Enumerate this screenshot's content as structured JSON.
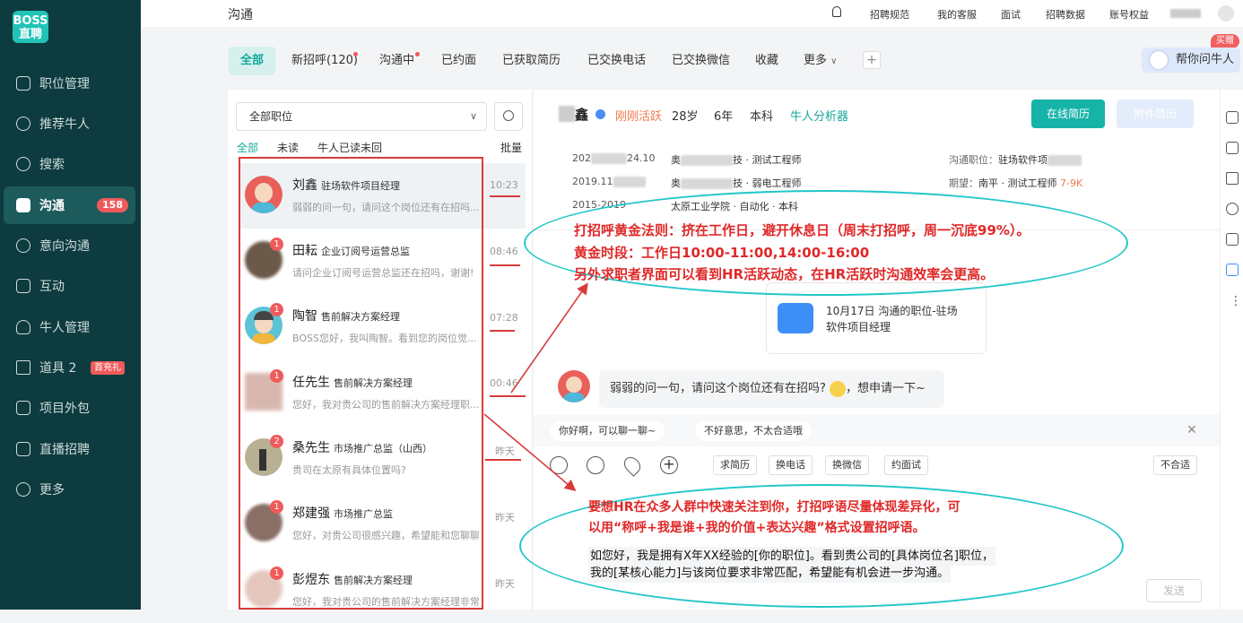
{
  "sidebar": {
    "logo_top": "BOSS",
    "logo_bottom": "直聘",
    "items": [
      {
        "label": "职位管理",
        "icon": "briefcase-icon"
      },
      {
        "label": "推荐牛人",
        "icon": "face-icon"
      },
      {
        "label": "搜索",
        "icon": "search-icon"
      },
      {
        "label": "沟通",
        "icon": "chat-icon",
        "badge": "158",
        "active": true
      },
      {
        "label": "意向沟通",
        "icon": "check-circle-icon"
      },
      {
        "label": "互动",
        "icon": "interaction-icon"
      },
      {
        "label": "牛人管理",
        "icon": "user-icon"
      },
      {
        "label": "道具 2",
        "icon": "star-icon",
        "badge": "首充礼"
      },
      {
        "label": "项目外包",
        "icon": "document-icon"
      },
      {
        "label": "直播招聘",
        "icon": "calendar-icon"
      },
      {
        "label": "更多",
        "icon": "more-icon"
      }
    ]
  },
  "topbar": {
    "title": "沟通",
    "links": [
      "招聘规范",
      "我的客服",
      "面试",
      "招聘数据",
      "账号权益"
    ]
  },
  "tabs": {
    "items": [
      "全部",
      "新招呼(120)",
      "沟通中",
      "已约面",
      "已获取简历",
      "已交换电话",
      "已交换微信",
      "收藏",
      "更多"
    ],
    "add": "+",
    "help": "帮你问牛人",
    "buy": "买赠"
  },
  "list": {
    "job_select": "全部职位",
    "filters": [
      "全部",
      "未读",
      "牛人已读未回"
    ],
    "batch": "批量",
    "contacts": [
      {
        "name": "刘鑫",
        "title": "驻场软件项目经理",
        "msg": "弱弱的问一句，请问这个岗位还有在招吗...",
        "time": "10:23",
        "unread": ""
      },
      {
        "name": "田耘",
        "title": "企业订阅号运营总监",
        "msg": "请问企业订阅号运营总监还在招吗，谢谢!",
        "time": "08:46",
        "unread": "1"
      },
      {
        "name": "陶智",
        "title": "售前解决方案经理",
        "msg": "BOSS您好，我叫陶智。看到您的岗位觉...",
        "time": "07:28",
        "unread": "1"
      },
      {
        "name": "任先生",
        "title": "售前解决方案经理",
        "msg": "您好，我对贵公司的售前解决方案经理职...",
        "time": "00:46",
        "unread": "1"
      },
      {
        "name": "桑先生",
        "title": "市场推广总监（山西）",
        "msg": "贵司在太原有具体位置吗?",
        "time": "昨天",
        "unread": "2"
      },
      {
        "name": "郑建强",
        "title": "市场推广总监",
        "msg": "您好，对贵公司很感兴趣，希望能和您聊聊",
        "time": "昨天",
        "unread": "1"
      },
      {
        "name": "彭煜东",
        "title": "售前解决方案经理",
        "msg": "您好，我对贵公司的售前解决方案经理非常感兴趣...",
        "time": "昨天",
        "unread": "1"
      }
    ]
  },
  "profile": {
    "name_suffix": "鑫",
    "active": "刚刚活跃",
    "age": "28岁",
    "years": "6年",
    "degree": "本科",
    "analyzer": "牛人分析器",
    "btn_resume": "在线简历",
    "btn_attach": "附件简历",
    "exp1_date_a": "202",
    "exp1_date_b": "24.10",
    "exp1_co": "奥",
    "exp1_role": "技 · 测试工程师",
    "exp2_date": "2019.11",
    "exp2_co": "奥",
    "exp2_role": "技 · 弱电工程师",
    "edu_date": "2015-2019",
    "edu": "太原工业学院 · 自动化 · 本科",
    "job_label": "沟通职位：",
    "job_value": "驻场软件项",
    "expect_label": "期望：",
    "expect_value": "南平 · 测试工程师",
    "salary": "7-9K"
  },
  "chat": {
    "card_title": "10月17日 沟通的职位-驻场",
    "card_sub": "软件项目经理",
    "message": "弱弱的问一句，请问这个岗位还有在招吗?",
    "message_tail": "，想申请一下~",
    "quick_replies": [
      "你好啊，可以聊一聊~",
      "不好意思，不太合适哦"
    ],
    "tools": [
      "求简历",
      "换电话",
      "换微信",
      "约面试"
    ],
    "reject": "不合适",
    "send": "发送"
  },
  "annotations": {
    "top_lines": [
      "打招呼黄金法则：挤在工作日，避开休息日（周末打招呼，周一沉底99%）。",
      "黄金时段：工作日10:00-11:00,14:00-16:00",
      "另外求职者界面可以看到HR活跃动态，在HR活跃时沟通效率会更高。"
    ],
    "bottom_lines": [
      "要想HR在众多人群中快速关注到你，打招呼语尽量体现差异化，可",
      "以用“称呼+我是谁+我的价值+表达兴趣”格式设置招呼语。"
    ],
    "example_lines": [
      "如您好，我是拥有X年XX经验的[你的职位]。看到贵公司的[具体岗位名]职位，",
      "我的[某核心能力]与该岗位要求非常匹配，希望能有机会进一步沟通。"
    ]
  },
  "colors": {
    "sidebar": "#0d3b3f",
    "accent": "#16b3a8",
    "annotation_red": "#e02828",
    "ellipse": "#22c6c9"
  }
}
